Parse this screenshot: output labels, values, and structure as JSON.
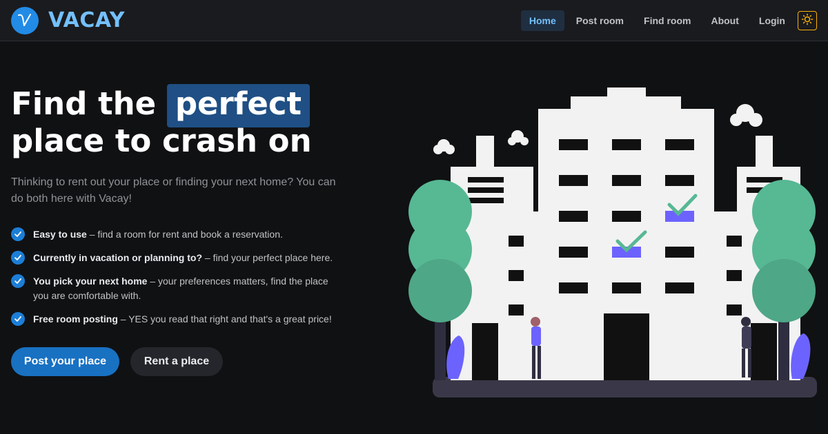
{
  "brand": {
    "name": "VACAY",
    "icon": "vacay-v-logo"
  },
  "nav": {
    "items": [
      {
        "label": "Home",
        "active": true
      },
      {
        "label": "Post room",
        "active": false
      },
      {
        "label": "Find room",
        "active": false
      },
      {
        "label": "About",
        "active": false
      },
      {
        "label": "Login",
        "active": false
      }
    ],
    "theme_toggle_icon": "sun-icon"
  },
  "hero": {
    "title_part1": "Find the",
    "title_highlight": "perfect",
    "title_part2": "place to crash on",
    "description": "Thinking to rent out your place or finding your next home? You can do both here with Vacay!",
    "features": [
      {
        "title": "Easy to use",
        "text": " – find a room for rent and book a reservation."
      },
      {
        "title": "Currently in vacation or planning to?",
        "text": " – find your perfect place here."
      },
      {
        "title": "You pick your next home",
        "text": " – your preferences matters, find the place you are comfortable with."
      },
      {
        "title": "Free room posting",
        "text": " – YES you read that right and that's a great price!"
      }
    ],
    "primary_button": "Post your place",
    "secondary_button": "Rent a place"
  },
  "colors": {
    "accent": "#228be6",
    "highlight_bg": "#1f4f84",
    "tree": "#57b894",
    "window_accent": "#6c63ff"
  }
}
